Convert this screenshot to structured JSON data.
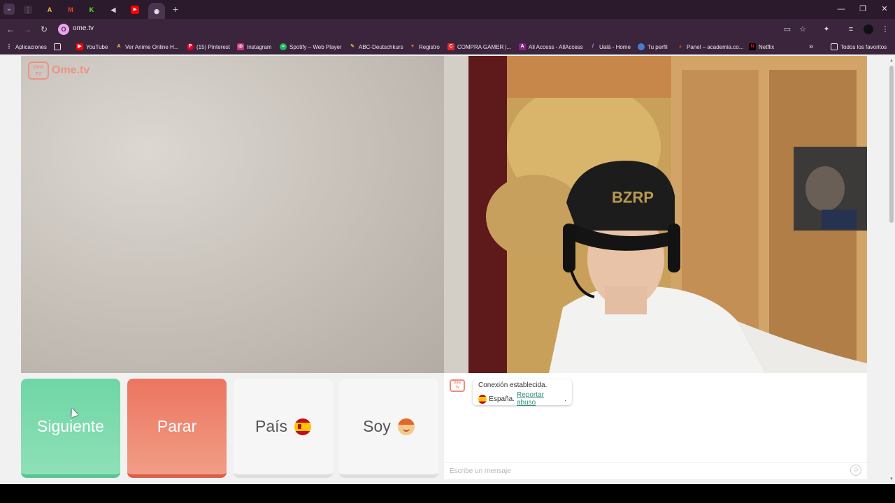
{
  "browser": {
    "url": "ome.tv",
    "tabs": [
      {
        "icon": "grid-icon"
      },
      {
        "icon": "AF-icon"
      },
      {
        "icon": "gmail-icon"
      },
      {
        "icon": "kick-icon"
      },
      {
        "icon": "speaker-icon"
      },
      {
        "icon": "youtube-icon"
      },
      {
        "icon": "record-icon"
      }
    ],
    "new_tab": "+"
  },
  "bookmarks": {
    "apps": "Aplicaciones",
    "items": [
      {
        "label": "YouTube",
        "color": "#ff0000"
      },
      {
        "label": "Ver Anime Online H...",
        "color": "#333333"
      },
      {
        "label": "(15) Pinterest",
        "color": "#e60023"
      },
      {
        "label": "Instagram",
        "color": "#c13584"
      },
      {
        "label": "Spotify – Web Player",
        "color": "#1db954"
      },
      {
        "label": "ABC-Deutschkurs",
        "color": "#d9a441"
      },
      {
        "label": "Registro",
        "color": "#e36b2b"
      },
      {
        "label": "COMPRA GAMER |...",
        "color": "#e3262c"
      },
      {
        "label": "All Access - AllAccess",
        "color": "#8a1f8a"
      },
      {
        "label": "Ualá - Home",
        "color": "#5a3fd6"
      },
      {
        "label": "Tu perfil",
        "color": "#4a7bd0"
      },
      {
        "label": "Panel – academia.co...",
        "color": "#c0392b"
      },
      {
        "label": "Netflix",
        "color": "#e50914"
      }
    ],
    "all_favorites": "Todos los favoritos"
  },
  "site": {
    "logo_text": "Ome.tv",
    "logo_badge": "Ome TV"
  },
  "controls": {
    "next_label": "Siguiente",
    "stop_label": "Parar",
    "country_label": "País",
    "me_label": "Soy"
  },
  "chat": {
    "status": "Conexión establecida.",
    "country": "España.",
    "report": "Reportar abuso",
    "period": ".",
    "placeholder": "Escribe un mensaje"
  },
  "colors": {
    "next": "#6fd6a6",
    "stop": "#eb7560",
    "brand": "#f08a7c"
  }
}
